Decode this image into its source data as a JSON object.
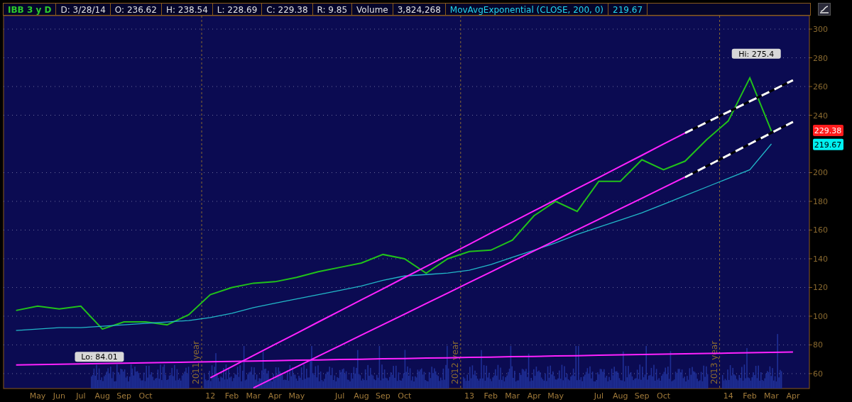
{
  "header": {
    "symbol": "IBB 3 y D",
    "fields": [
      "D: 3/28/14",
      "O: 236.62",
      "H: 238.54",
      "L: 228.69",
      "C: 229.38",
      "R: 9.85",
      "Volume",
      "3,824,268"
    ],
    "study": {
      "label": "MovAvgExponential (CLOSE, 200, 0)",
      "value": "219.67"
    }
  },
  "chart": {
    "chart_data": {
      "type": "line",
      "categories": [
        null,
        "May",
        "Jun",
        "Jul",
        "Aug",
        "Sep",
        "Oct",
        null,
        null,
        "12",
        "Feb",
        "Mar",
        "Apr",
        "May",
        null,
        "Jul",
        "Aug",
        "Sep",
        "Oct",
        null,
        null,
        "13",
        "Feb",
        "Mar",
        "Apr",
        "May",
        null,
        "Jul",
        "Aug",
        "Sep",
        "Oct",
        null,
        null,
        "14",
        "Feb",
        "Mar",
        "Apr"
      ],
      "series": [
        {
          "color": "#21c21a",
          "values": [
            104,
            107,
            105,
            107,
            91,
            96,
            96,
            94,
            101,
            115,
            120,
            123,
            124,
            127,
            131,
            134,
            137,
            143,
            140,
            130,
            140,
            145,
            146,
            153,
            170,
            180,
            173,
            194,
            194,
            209,
            202,
            208,
            223,
            236,
            266,
            229,
            null
          ]
        },
        {
          "color": "#22b8c8",
          "values": [
            90,
            91,
            92,
            92,
            93,
            94,
            95,
            96,
            97,
            99,
            102,
            106,
            109,
            112,
            115,
            118,
            121,
            125,
            128,
            129,
            130,
            132,
            136,
            141,
            146,
            151,
            157,
            162,
            167,
            172,
            178,
            184,
            190,
            196,
            202,
            220,
            null
          ]
        },
        {
          "color": "#ff22ff",
          "values": [
            null,
            null,
            null,
            null,
            null,
            null,
            null,
            null,
            null,
            57.1,
            64.9,
            72.6,
            80.4,
            88.1,
            95.9,
            103.6,
            111.4,
            119.1,
            126.9,
            134.6,
            142.4,
            150.1,
            157.9,
            165.6,
            173.4,
            181.1,
            188.9,
            196.6,
            204.4,
            212.1,
            219.9,
            227.6,
            null,
            null,
            null,
            null,
            null
          ]
        },
        {
          "color": "#ffffff",
          "line_style": "dashed",
          "values": [
            null,
            null,
            null,
            null,
            null,
            null,
            null,
            null,
            null,
            null,
            null,
            null,
            null,
            null,
            null,
            null,
            null,
            null,
            null,
            null,
            null,
            null,
            null,
            null,
            null,
            null,
            null,
            null,
            null,
            null,
            null,
            227.6,
            235.0,
            242.3,
            249.7,
            257.0,
            264.4
          ]
        },
        {
          "color": "#ff22ff",
          "values": [
            null,
            null,
            null,
            null,
            null,
            null,
            null,
            null,
            null,
            null,
            null,
            50.0,
            57.4,
            64.7,
            72.1,
            79.4,
            86.8,
            94.1,
            101.4,
            108.8,
            116.1,
            123.5,
            130.8,
            138.2,
            145.5,
            152.8,
            160.2,
            167.5,
            174.9,
            182.2,
            189.6,
            196.9,
            null,
            null,
            null,
            null,
            null
          ]
        },
        {
          "color": "#ffffff",
          "line_style": "dashed",
          "values": [
            null,
            null,
            null,
            null,
            null,
            null,
            null,
            null,
            null,
            null,
            null,
            null,
            null,
            null,
            null,
            null,
            null,
            null,
            null,
            null,
            null,
            null,
            null,
            null,
            null,
            null,
            null,
            null,
            null,
            null,
            null,
            196.8,
            204.5,
            212.2,
            220.0,
            227.7,
            235.4
          ]
        },
        {
          "color": "#ff22ff",
          "values": [
            66.0,
            66.3,
            66.5,
            66.8,
            67.0,
            67.3,
            67.5,
            67.8,
            68.0,
            68.3,
            68.5,
            68.8,
            69.0,
            69.3,
            69.5,
            69.8,
            70.0,
            70.3,
            70.5,
            70.8,
            71.0,
            71.3,
            71.5,
            71.8,
            72.0,
            72.3,
            72.5,
            72.8,
            73.0,
            73.3,
            73.5,
            73.8,
            74.0,
            74.3,
            74.5,
            74.8,
            75.0
          ]
        }
      ],
      "ylim": [
        49.6,
        309.4
      ],
      "grid": true,
      "yticks": [
        60,
        80,
        100,
        120,
        140,
        160,
        180,
        200,
        240,
        260,
        280,
        300
      ]
    },
    "year_labels": [
      "2011 year",
      "2012 year",
      "2013 year"
    ],
    "callouts": [
      "Hi: 275.4",
      "Lo: 84.01"
    ],
    "price_tags": [
      {
        "text": "229.38",
        "color": "#ff1c1c"
      },
      {
        "text": "219.67",
        "color": "#00f0f0"
      }
    ]
  }
}
